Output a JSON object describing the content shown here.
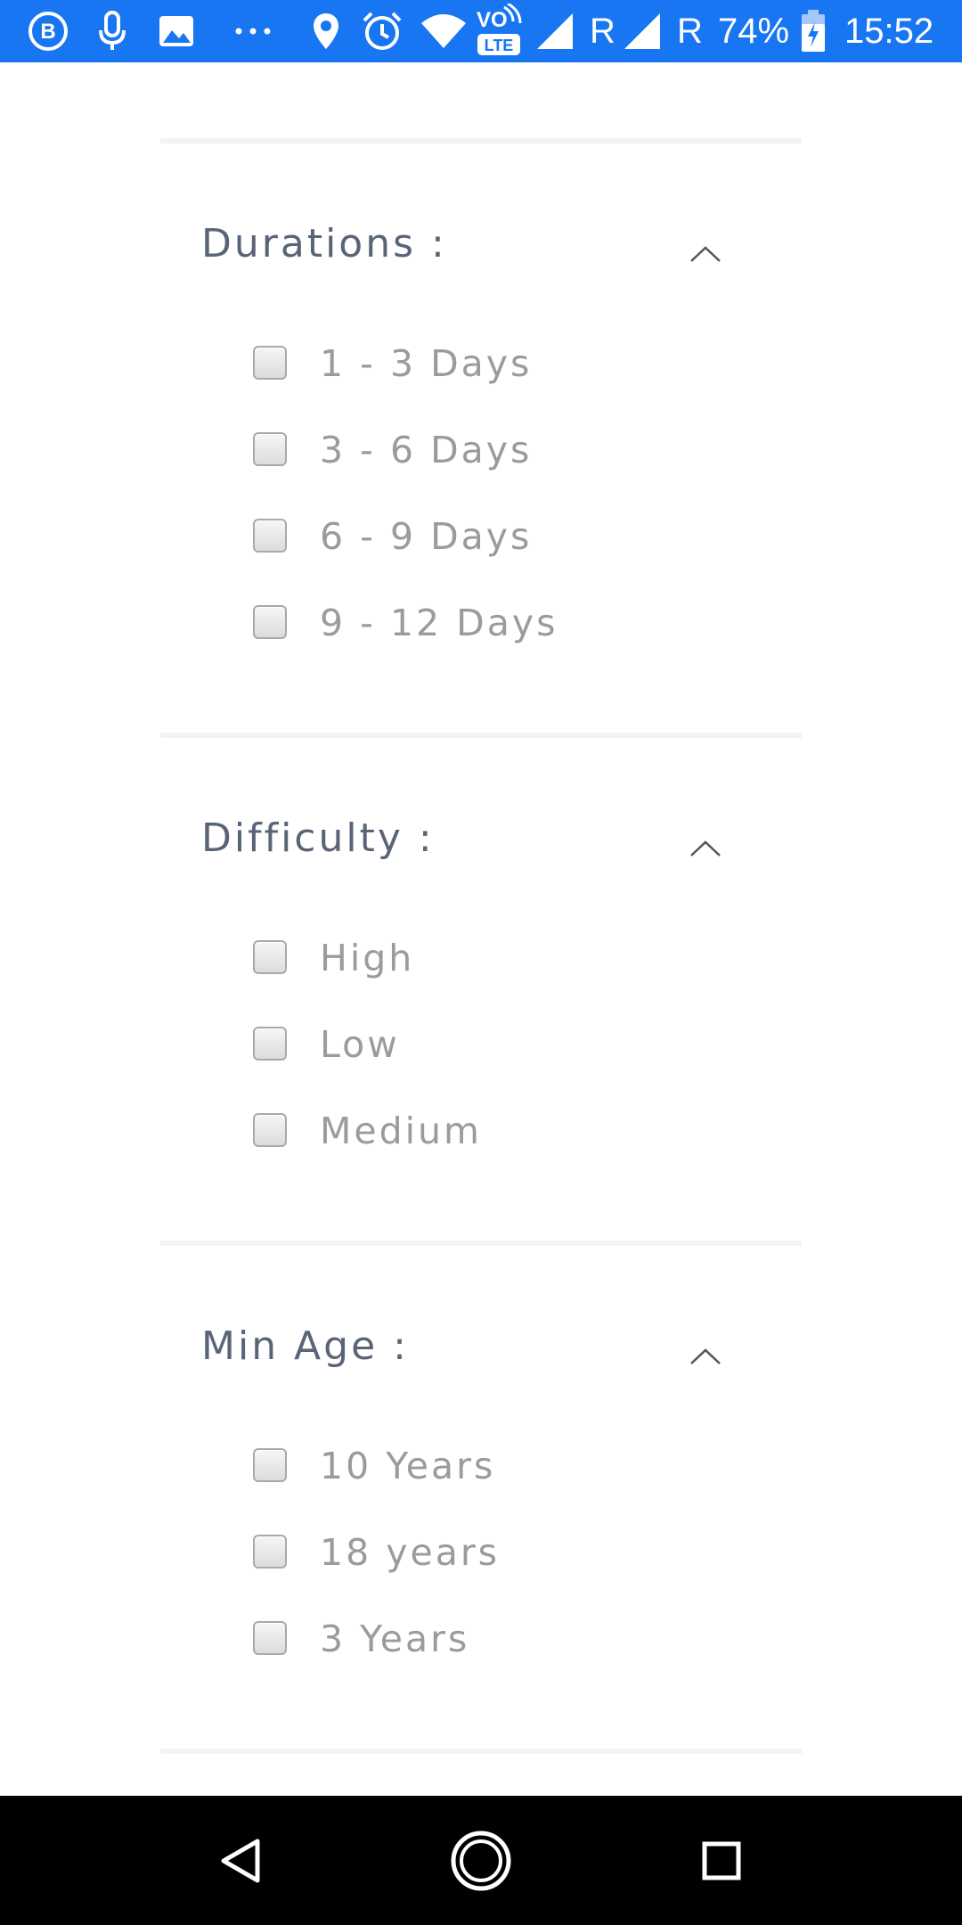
{
  "status_bar": {
    "battery": "74%",
    "time": "15:52",
    "roaming_1": "R",
    "roaming_2": "R",
    "lte_label": "LTE",
    "volte_label": "VO",
    "app_badge": "B",
    "icons": [
      "app-b-icon",
      "microphone-icon",
      "image-icon",
      "more-dots-icon",
      "location-pin-icon",
      "alarm-icon",
      "wifi-icon",
      "volte-icon",
      "signal-icon",
      "signal-icon",
      "battery-charging-icon"
    ]
  },
  "filters": {
    "durations": {
      "title": "Durations :",
      "options": [
        {
          "label": "1 - 3 Days",
          "checked": false
        },
        {
          "label": "3 - 6 Days",
          "checked": false
        },
        {
          "label": "6 - 9 Days",
          "checked": false
        },
        {
          "label": "9 - 12 Days",
          "checked": false
        }
      ]
    },
    "difficulty": {
      "title": "Difficulty :",
      "options": [
        {
          "label": "High",
          "checked": false
        },
        {
          "label": "Low",
          "checked": false
        },
        {
          "label": "Medium",
          "checked": false
        }
      ]
    },
    "min_age": {
      "title": "Min Age :",
      "options": [
        {
          "label": "10 Years",
          "checked": false
        },
        {
          "label": "18 years",
          "checked": false
        },
        {
          "label": "3 Years",
          "checked": false
        }
      ]
    }
  },
  "nav_bar": {
    "icons": [
      "back-icon",
      "home-icon",
      "recents-icon"
    ]
  },
  "colors": {
    "status_bar": "#1976f2",
    "title_text": "#5a6478",
    "option_text": "#9b9b9b",
    "divider": "#f3f3f3",
    "nav_bar": "#000000"
  }
}
